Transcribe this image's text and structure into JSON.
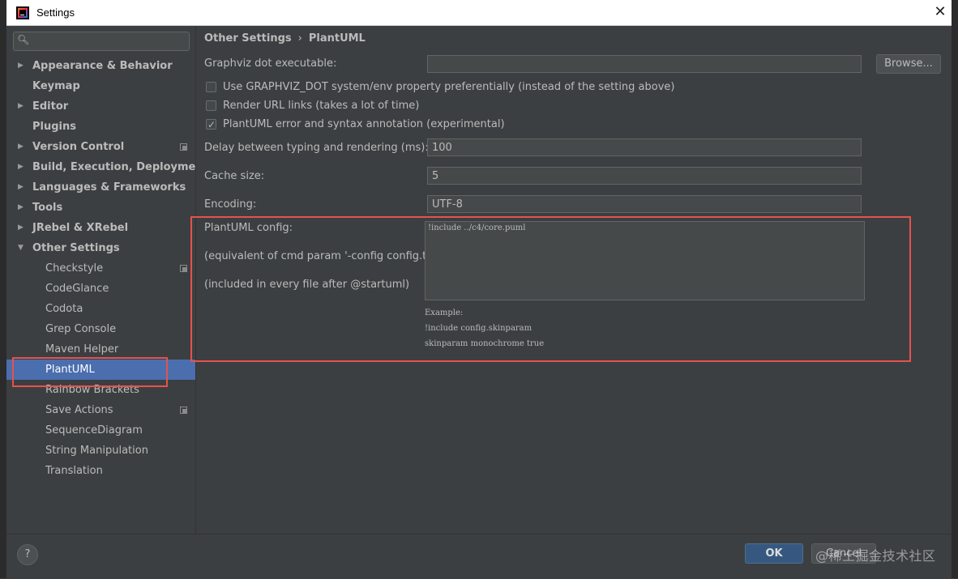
{
  "window": {
    "title": "Settings"
  },
  "sidebar": {
    "search_value": "",
    "items": [
      {
        "label": "Appearance & Behavior",
        "expandable": true,
        "expanded": false
      },
      {
        "label": "Keymap"
      },
      {
        "label": "Editor",
        "expandable": true,
        "expanded": false
      },
      {
        "label": "Plugins"
      },
      {
        "label": "Version Control",
        "expandable": true,
        "expanded": false,
        "project_icon": true
      },
      {
        "label": "Build, Execution, Deployment",
        "expandable": true,
        "expanded": false
      },
      {
        "label": "Languages & Frameworks",
        "expandable": true,
        "expanded": false
      },
      {
        "label": "Tools",
        "expandable": true,
        "expanded": false
      },
      {
        "label": "JRebel & XRebel",
        "expandable": true,
        "expanded": false
      },
      {
        "label": "Other Settings",
        "expandable": true,
        "expanded": true
      },
      {
        "label": "Checkstyle",
        "child": true,
        "project_icon": true
      },
      {
        "label": "CodeGlance",
        "child": true
      },
      {
        "label": "Codota",
        "child": true
      },
      {
        "label": "Grep Console",
        "child": true
      },
      {
        "label": "Maven Helper",
        "child": true
      },
      {
        "label": "PlantUML",
        "child": true,
        "selected": true
      },
      {
        "label": "Rainbow Brackets",
        "child": true
      },
      {
        "label": "Save Actions",
        "child": true,
        "project_icon": true
      },
      {
        "label": "SequenceDiagram",
        "child": true
      },
      {
        "label": "String Manipulation",
        "child": true
      },
      {
        "label": "Translation",
        "child": true
      }
    ]
  },
  "breadcrumb": {
    "parent": "Other Settings",
    "current": "PlantUML",
    "separator": "›"
  },
  "form": {
    "graphviz_label": "Graphviz dot executable:",
    "graphviz_value": "",
    "browse_label": "Browse...",
    "checkboxes": [
      {
        "label": "Use GRAPHVIZ_DOT system/env property preferentially (instead of the setting above)",
        "checked": false
      },
      {
        "label": "Render URL links (takes a lot of time)",
        "checked": false
      },
      {
        "label": "PlantUML error and syntax annotation (experimental)",
        "checked": true
      }
    ],
    "delay_label": "Delay between typing and rendering (ms):",
    "delay_value": "100",
    "cache_label": "Cache size:",
    "cache_value": "5",
    "encoding_label": "Encoding:",
    "encoding_value": "UTF-8",
    "config_label": "PlantUML config:",
    "config_hint1": "(equivalent of cmd param '-config config.txt')",
    "config_hint2": "(included in every file after @startuml)",
    "config_value": "!include ../c4/core.puml",
    "example_title": "Example:",
    "example_line1": "!include config.skinparam",
    "example_line2": "skinparam monochrome true"
  },
  "footer": {
    "help_label": "?",
    "ok_label": "OK",
    "cancel_label": "Cancel",
    "watermark": "@稀土掘金技术社区"
  },
  "colors": {
    "background": "#3c3f41",
    "selection": "#4b6eaf",
    "ok_button": "#365880",
    "highlight": "#e5524d"
  }
}
